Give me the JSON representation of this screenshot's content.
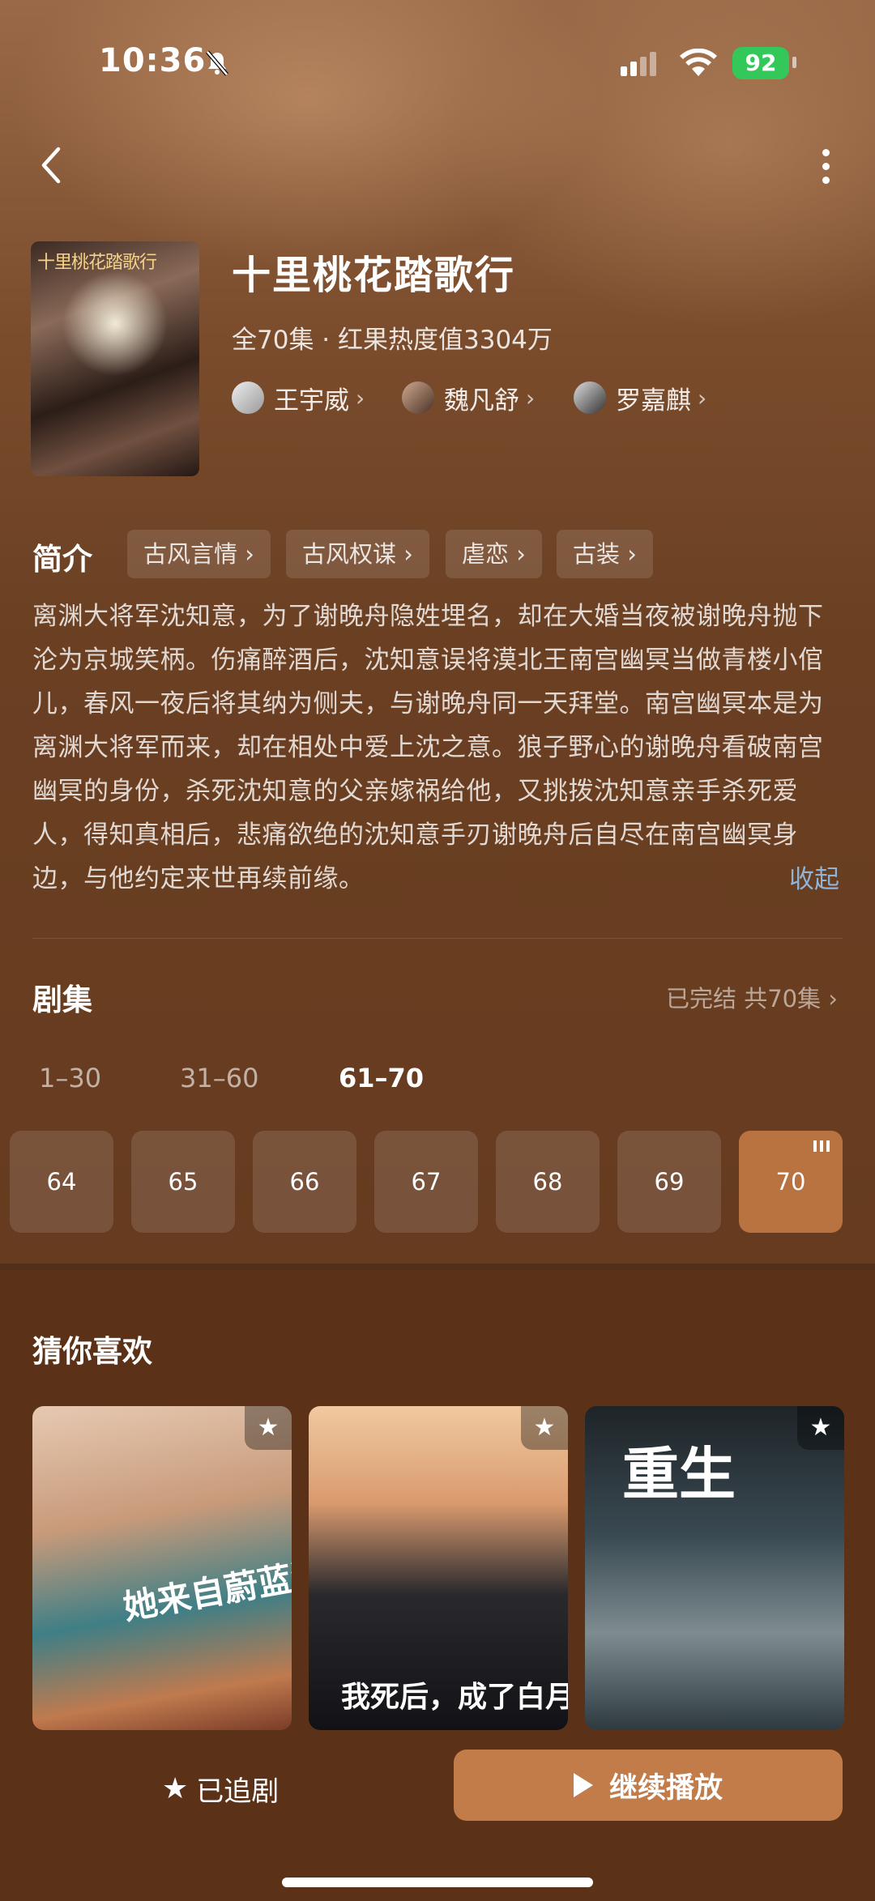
{
  "status_bar": {
    "time": "10:36",
    "battery": "92"
  },
  "show": {
    "title": "十里桃花踏歌行",
    "meta": "全70集 · 红果热度值3304万",
    "poster_title": "十里桃花踏歌行",
    "cast": [
      {
        "name": "王宇威"
      },
      {
        "name": "魏凡舒"
      },
      {
        "name": "罗嘉麒"
      }
    ]
  },
  "intro": {
    "label": "简介",
    "tags": [
      "古风言情",
      "古风权谋",
      "虐恋",
      "古装"
    ],
    "description": "离渊大将军沈知意，为了谢晚舟隐姓埋名，却在大婚当夜被谢晚舟抛下沦为京城笑柄。伤痛醉酒后，沈知意误将漠北王南宫幽冥当做青楼小倌儿，春风一夜后将其纳为侧夫，与谢晚舟同一天拜堂。南宫幽冥本是为离渊大将军而来，却在相处中爱上沈之意。狼子野心的谢晚舟看破南宫幽冥的身份，杀死沈知意的父亲嫁祸给他，又挑拨沈知意亲手杀死爱人，得知真相后，悲痛欲绝的沈知意手刃谢晚舟后自尽在南宫幽冥身边，与他约定来世再续前缘。",
    "collapse": "收起"
  },
  "episodes": {
    "label": "剧集",
    "status": "已完结 共70集",
    "ranges": [
      "1–30",
      "31–60",
      "61–70"
    ],
    "active_range": "61–70",
    "items": [
      "64",
      "65",
      "66",
      "67",
      "68",
      "69",
      "70"
    ],
    "active_episode": "70"
  },
  "recommend": {
    "label": "猜你喜欢",
    "cards": [
      {
        "art_text": "她来自蔚蓝深处"
      },
      {
        "art_text": "我死后，成了白月光"
      },
      {
        "art_text": "重生"
      }
    ]
  },
  "bottom": {
    "follow_label": "已追剧",
    "play_label": "继续播放"
  },
  "colors": {
    "accent": "#c17c4a",
    "active_episode_bg": "#b97340",
    "link": "#8fb4d8",
    "battery": "#34c759"
  }
}
